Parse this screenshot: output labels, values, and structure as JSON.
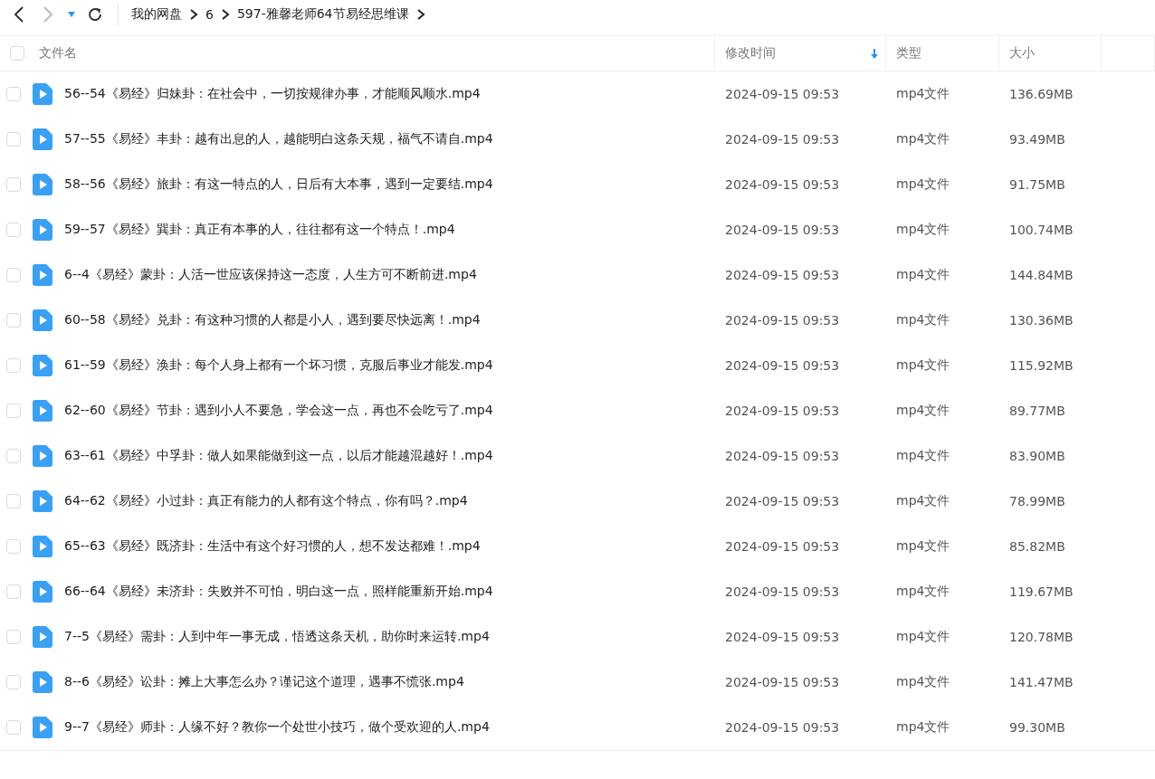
{
  "breadcrumb": [
    "我的网盘",
    "6",
    "597-雅馨老师64节易经思维课"
  ],
  "header": {
    "checked": false,
    "columns": [
      {
        "label": "文件名",
        "sorted": false
      },
      {
        "label": "修改时间",
        "sorted": true
      },
      {
        "label": "类型",
        "sorted": false
      },
      {
        "label": "大小",
        "sorted": false
      }
    ]
  },
  "rows": [
    {
      "name": "56--54《易经》归妹卦：在社会中，一切按规律办事，才能顺风顺水.mp4",
      "modified": "2024-09-15 09:53",
      "type": "mp4文件",
      "size": "136.69MB",
      "checked": false
    },
    {
      "name": "57--55《易经》丰卦：越有出息的人，越能明白这条天规，福气不请自.mp4",
      "modified": "2024-09-15 09:53",
      "type": "mp4文件",
      "size": "93.49MB",
      "checked": false
    },
    {
      "name": "58--56《易经》旅卦：有这一特点的人，日后有大本事，遇到一定要结.mp4",
      "modified": "2024-09-15 09:53",
      "type": "mp4文件",
      "size": "91.75MB",
      "checked": false
    },
    {
      "name": "59--57《易经》巽卦：真正有本事的人，往往都有这一个特点！.mp4",
      "modified": "2024-09-15 09:53",
      "type": "mp4文件",
      "size": "100.74MB",
      "checked": false
    },
    {
      "name": "6--4《易经》蒙卦：人活一世应该保持这一态度，人生方可不断前进.mp4",
      "modified": "2024-09-15 09:53",
      "type": "mp4文件",
      "size": "144.84MB",
      "checked": false
    },
    {
      "name": "60--58《易经》兑卦：有这种习惯的人都是小人，遇到要尽快远离！.mp4",
      "modified": "2024-09-15 09:53",
      "type": "mp4文件",
      "size": "130.36MB",
      "checked": false
    },
    {
      "name": "61--59《易经》涣卦：每个人身上都有一个坏习惯，克服后事业才能发.mp4",
      "modified": "2024-09-15 09:53",
      "type": "mp4文件",
      "size": "115.92MB",
      "checked": false
    },
    {
      "name": "62--60《易经》节卦：遇到小人不要急，学会这一点，再也不会吃亏了.mp4",
      "modified": "2024-09-15 09:53",
      "type": "mp4文件",
      "size": "89.77MB",
      "checked": false
    },
    {
      "name": "63--61《易经》中孚卦：做人如果能做到这一点，以后才能越混越好！.mp4",
      "modified": "2024-09-15 09:53",
      "type": "mp4文件",
      "size": "83.90MB",
      "checked": false
    },
    {
      "name": "64--62《易经》小过卦：真正有能力的人都有这个特点，你有吗？.mp4",
      "modified": "2024-09-15 09:53",
      "type": "mp4文件",
      "size": "78.99MB",
      "checked": false
    },
    {
      "name": "65--63《易经》既济卦：生活中有这个好习惯的人，想不发达都难！.mp4",
      "modified": "2024-09-15 09:53",
      "type": "mp4文件",
      "size": "85.82MB",
      "checked": false
    },
    {
      "name": "66--64《易经》未济卦：失败并不可怕，明白这一点，照样能重新开始.mp4",
      "modified": "2024-09-15 09:53",
      "type": "mp4文件",
      "size": "119.67MB",
      "checked": false
    },
    {
      "name": "7--5《易经》需卦：人到中年一事无成，悟透这条天机，助你时来运转.mp4",
      "modified": "2024-09-15 09:53",
      "type": "mp4文件",
      "size": "120.78MB",
      "checked": false
    },
    {
      "name": "8--6《易经》讼卦：摊上大事怎么办？谨记这个道理，遇事不慌张.mp4",
      "modified": "2024-09-15 09:53",
      "type": "mp4文件",
      "size": "141.47MB",
      "checked": false
    },
    {
      "name": "9--7《易经》师卦：人缘不好？教你一个处世小技巧，做个受欢迎的人.mp4",
      "modified": "2024-09-15 09:53",
      "type": "mp4文件",
      "size": "99.30MB",
      "checked": false
    }
  ]
}
